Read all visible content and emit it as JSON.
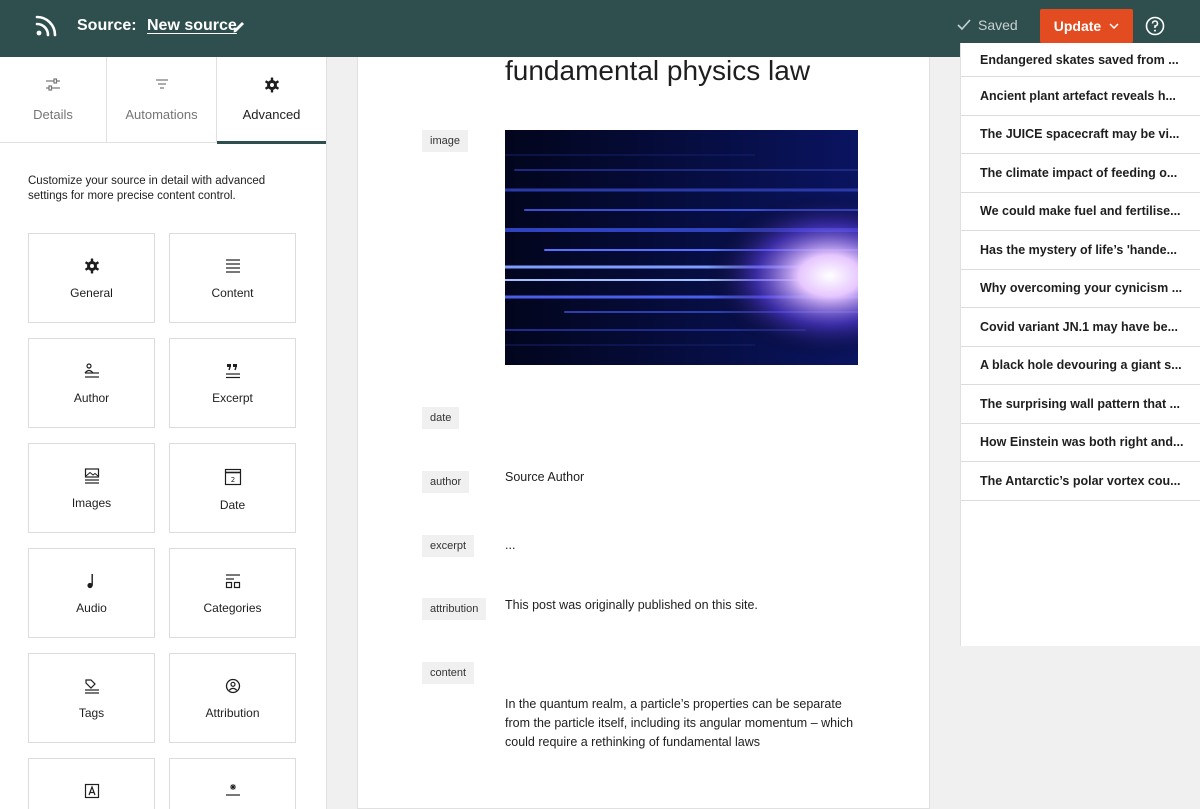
{
  "header": {
    "source_label": "Source:",
    "source_name": "New source",
    "status": "Saved",
    "update_label": "Update"
  },
  "sidebar": {
    "tabs": [
      {
        "label": "Details",
        "icon": "sliders-icon"
      },
      {
        "label": "Automations",
        "icon": "filter-icon"
      },
      {
        "label": "Advanced",
        "icon": "gear-icon",
        "active": true
      }
    ],
    "intro": "Customize your source in detail with advanced settings for more precise content control.",
    "cards": [
      {
        "label": "General",
        "icon": "gear-icon"
      },
      {
        "label": "Content",
        "icon": "align-justify-icon"
      },
      {
        "label": "Author",
        "icon": "author-icon"
      },
      {
        "label": "Excerpt",
        "icon": "quote-icon"
      },
      {
        "label": "Images",
        "icon": "image-icon"
      },
      {
        "label": "Date",
        "icon": "calendar-icon"
      },
      {
        "label": "Audio",
        "icon": "music-note-icon"
      },
      {
        "label": "Categories",
        "icon": "categories-icon"
      },
      {
        "label": "Tags",
        "icon": "tag-icon"
      },
      {
        "label": "Attribution",
        "icon": "face-icon"
      }
    ]
  },
  "post": {
    "title_fragment": "fundamental physics law",
    "fields": {
      "image": "image",
      "date": "date",
      "author": "author",
      "excerpt": "excerpt",
      "attribution": "attribution",
      "content": "content"
    },
    "author_value": "Source Author",
    "excerpt_value": "...",
    "attribution_value": "This post was originally published on this site.",
    "content_value": "In the quantum realm, a particle’s properties can be separate from the particle itself, including its angular momentum – which could require a rethinking of fundamental laws"
  },
  "article_list": [
    "Endangered skates saved from ...",
    "Ancient plant artefact reveals h...",
    "The JUICE spacecraft may be vi...",
    "The climate impact of feeding o...",
    "We could make fuel and fertilise...",
    "Has the mystery of life’s 'hande...",
    "Why overcoming your cynicism ...",
    "Covid variant JN.1 may have be...",
    "A black hole devouring a giant s...",
    "The surprising wall pattern that ...",
    "How Einstein was both right and...",
    "The Antarctic’s polar vortex cou..."
  ],
  "colors": {
    "header_bg": "#2f4f4f",
    "accent": "#e34c20"
  }
}
